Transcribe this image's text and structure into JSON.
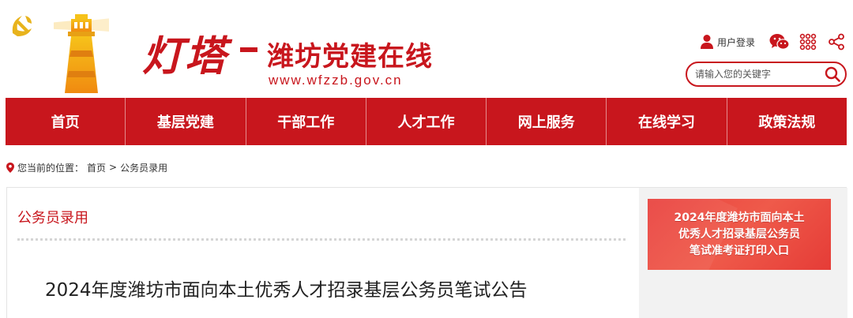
{
  "header": {
    "brand": "灯塔",
    "site_name": "潍坊党建在线",
    "site_url": "www.wfzzb.gov.cn",
    "login_label": "用户登录",
    "icons": [
      "user-icon",
      "wechat-icon",
      "apps-grid-icon",
      "share-icon"
    ],
    "search_placeholder": "请输入您的关键字"
  },
  "nav": {
    "items": [
      "首页",
      "基层党建",
      "干部工作",
      "人才工作",
      "网上服务",
      "在线学习",
      "政策法规"
    ]
  },
  "breadcrumb": {
    "prefix": "您当前的位置：",
    "home": "首页",
    "separator": ">",
    "current": "公务员录用"
  },
  "content": {
    "section_title": "公务员录用",
    "article_title": "2024年度潍坊市面向本土优秀人才招录基层公务员笔试公告"
  },
  "sidebar": {
    "banner_lines": [
      "2024年度潍坊市面向本土",
      "优秀人才招录基层公务员",
      "笔试准考证打印入口"
    ]
  },
  "colors": {
    "brand_red": "#c8161d",
    "banner_red": "#e9433f",
    "sidebar_bg": "#f2f2f2"
  }
}
